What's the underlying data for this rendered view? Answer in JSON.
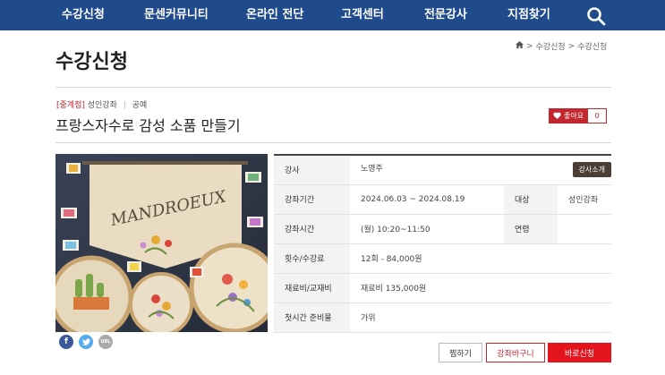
{
  "nav": {
    "items": [
      "수강신청",
      "문센커뮤니티",
      "온라인 전단",
      "고객센터",
      "전문강사",
      "지점찾기"
    ],
    "search_icon": "search-icon"
  },
  "header": {
    "title": "수강신청",
    "breadcrumb": [
      "수강신청",
      "수강신청"
    ]
  },
  "course": {
    "branch": "[중계점]",
    "category": "성인강좌",
    "subcategory": "공예",
    "title": "프랑스자수로 감성 소품 만들기",
    "like_label": "좋아요",
    "like_count": "0"
  },
  "info": {
    "teacher_label": "강사",
    "teacher_value": "노영주",
    "teacher_button": "강사소개",
    "period_label": "강좌기간",
    "period_value": "2024.06.03 ~ 2024.08.19",
    "target_label": "대상",
    "target_value": "성인강좌",
    "time_label": "강좌시간",
    "time_value": "(월) 10:20~11:50",
    "age_label": "연령",
    "age_value": "",
    "fee_label": "횟수/수강료",
    "fee_value": "12회 - 84,000원",
    "material_label": "재료비/교재비",
    "material_value": "재료비 135,000원",
    "prep_label": "첫시간 준비물",
    "prep_value": "가위"
  },
  "share": {
    "url_label": "URL"
  },
  "actions": {
    "wish": "찜하기",
    "cart": "강좌바구니",
    "apply": "바로신청"
  },
  "colors": {
    "nav_bg": "#1f4a8c",
    "accent_red": "#c1272d",
    "apply_red": "#e3141c",
    "teacher_btn": "#4a3e36"
  }
}
